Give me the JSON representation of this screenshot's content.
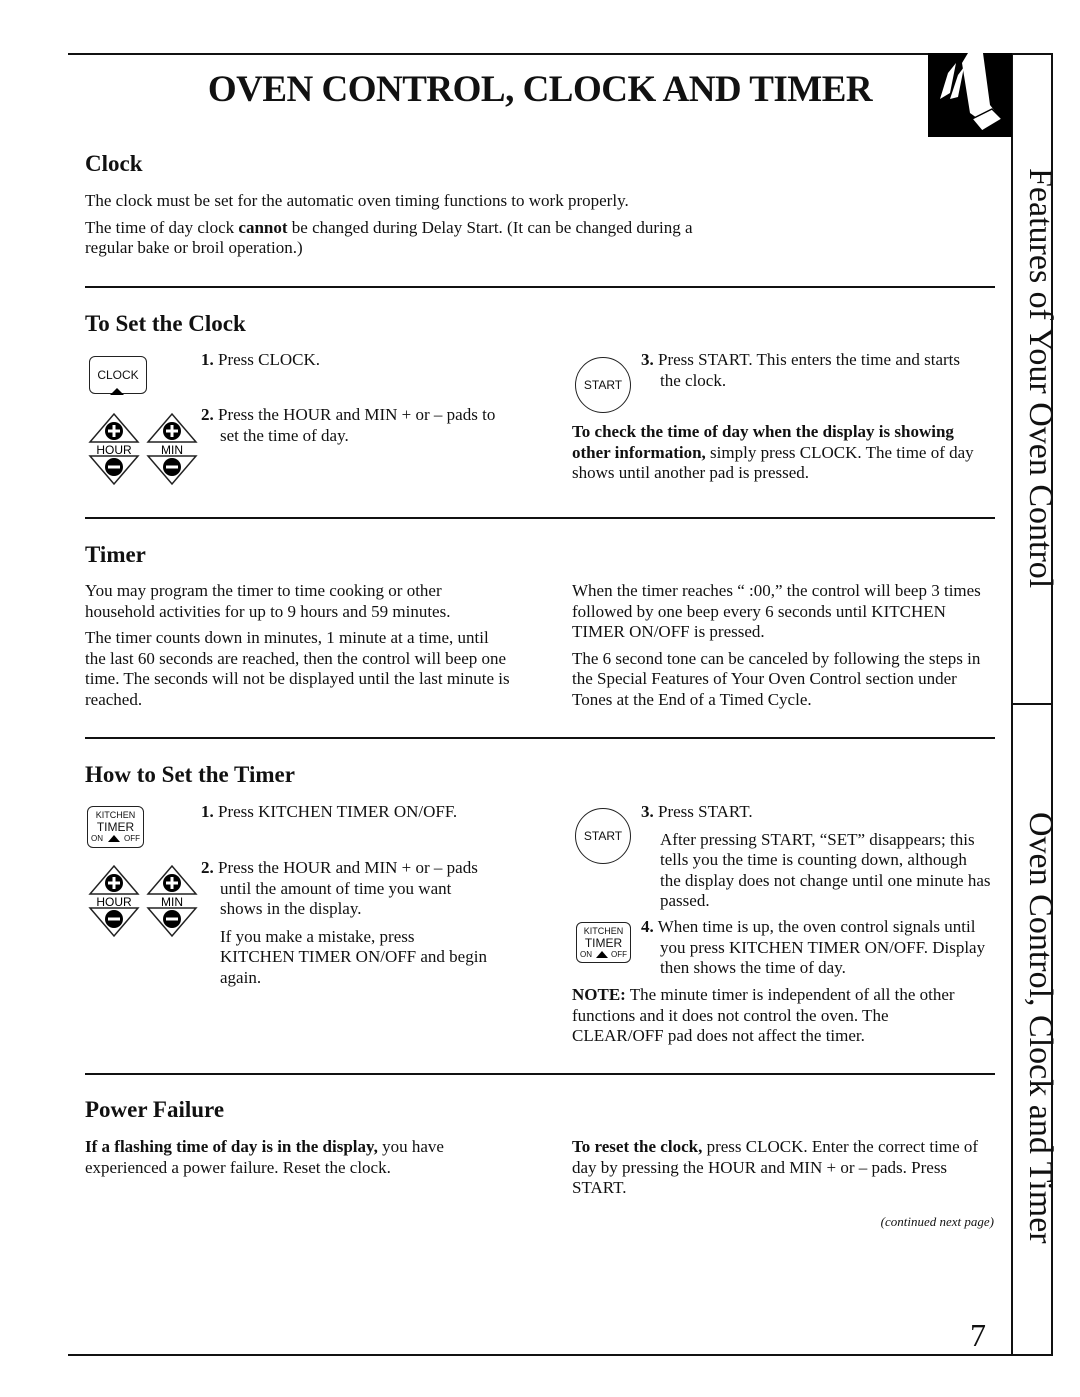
{
  "title": "OVEN CONTROL, CLOCK AND TIMER",
  "sidebar": {
    "top": "Features of Your Oven Control",
    "bottom": "Oven Control, Clock and Timer"
  },
  "page_number": "7",
  "continued": "(continued next page)",
  "clock": {
    "heading": "Clock",
    "p1": "The clock must be set for the automatic oven timing functions to work properly.",
    "p2a": "The time of day clock ",
    "p2b": "cannot",
    "p2c": " be changed during Delay Start. (It can be changed during a regular bake or broil operation.)"
  },
  "set_clock": {
    "heading": "To Set the Clock",
    "s1n": "1.",
    "s1": "Press CLOCK.",
    "s2n": "2.",
    "s2": "Press the HOUR and MIN + or – pads to set the time of day.",
    "s3n": "3.",
    "s3": "Press START. This enters the time and starts the clock.",
    "check_bold": "To check the time of day when the display is showing other information,",
    "check": " simply press CLOCK. The time of day shows until another pad is pressed."
  },
  "pads": {
    "clock": "CLOCK",
    "start": "START",
    "hour": "HOUR",
    "min": "MIN",
    "kitchen": "KITCHEN",
    "timer": "TIMER",
    "on": "ON",
    "off": "OFF"
  },
  "timer": {
    "heading": "Timer",
    "l1": "You may program the timer to time cooking or other household activities for up to 9 hours and 59 minutes.",
    "l2": "The timer counts down in minutes, 1 minute at a time, until the last 60 seconds are reached, then the control will beep one time. The seconds will not be displayed until the last minute is reached.",
    "r1": "When the timer reaches “ :00,” the control will beep 3 times followed by one beep every 6 seconds until KITCHEN TIMER ON/OFF is pressed.",
    "r2": "The 6 second tone can be canceled by following the steps in the Special Features of Your Oven Control section under Tones at the End of a Timed Cycle."
  },
  "set_timer": {
    "heading": "How to Set the Timer",
    "s1n": "1.",
    "s1": "Press KITCHEN TIMER ON/OFF.",
    "s2n": "2.",
    "s2": "Press the HOUR and MIN + or – pads until the amount of time you want shows in the display.",
    "mistake": "If you make a mistake, press KITCHEN TIMER ON/OFF and begin again.",
    "s3n": "3.",
    "s3": "Press START.",
    "s3b": "After pressing START, “SET” disappears; this tells you the time is counting down, although the display does not change until one minute has passed.",
    "s4n": "4.",
    "s4": "When time is up, the oven control signals until you press KITCHEN TIMER ON/OFF. Display then shows the time of day.",
    "note_bold": "NOTE:",
    "note": " The minute timer is independent of all the other functions and it does not control the oven. The CLEAR/OFF pad does not affect the timer."
  },
  "power": {
    "heading": "Power Failure",
    "l_bold": "If a flashing time of day is in the display,",
    "l": " you have experienced a power failure. Reset the clock.",
    "r_bold": "To reset the clock,",
    "r": " press CLOCK. Enter the correct time of day by pressing the HOUR and MIN + or – pads. Press START."
  }
}
